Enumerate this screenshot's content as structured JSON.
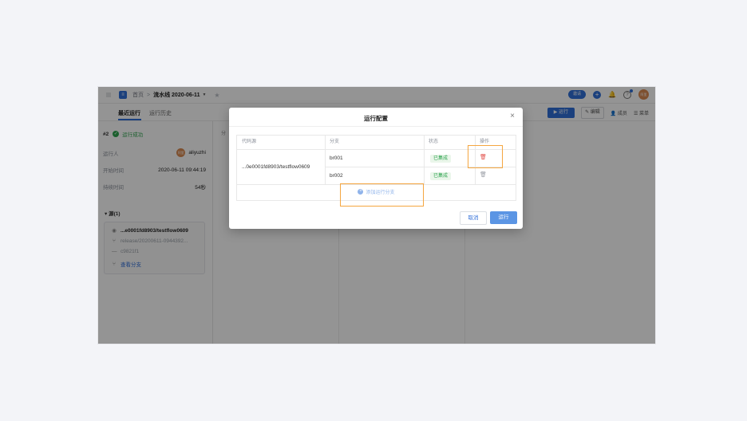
{
  "header": {
    "home": "首页",
    "separator": ">",
    "pipeline_name": "流水线 2020-06-11",
    "invite_label": "邀请",
    "avatar_text": "阿里"
  },
  "subbar": {
    "tabs": [
      {
        "label": "最近运行"
      },
      {
        "label": "运行历史"
      }
    ],
    "run_label": "运行",
    "edit_label": "编辑",
    "members_label": "成员",
    "menu_label": "菜单"
  },
  "run": {
    "number": "#2",
    "status": "运行成功",
    "runner_label": "运行人",
    "runner_name": "aliyuzhi",
    "runner_avatar": "阿里",
    "start_label": "开始时间",
    "start_time": "2020-06-11 09:44:19",
    "duration_label": "持续时间",
    "duration": "54秒"
  },
  "sources": {
    "section_title": "源(1)",
    "repo": "...e0001fd8903/testflow0609",
    "branch": "release/20200611-0944392...",
    "commit": "c9821f1",
    "view_branches": "查看分支"
  },
  "background": {
    "col_text": "分"
  },
  "modal": {
    "title": "运行配置",
    "columns": [
      "代码源",
      "分支",
      "状态",
      "操作"
    ],
    "repo": "...0e0001fd8903/testflow0609",
    "rows": [
      {
        "branch": "br001",
        "status": "已集成"
      },
      {
        "branch": "br002",
        "status": "已集成"
      }
    ],
    "add_branch": "添加运行分支",
    "cancel": "取消",
    "run": "运行"
  },
  "colors": {
    "accent": "#2f6ed8",
    "success": "#2ea44f",
    "highlight": "#f5a640",
    "danger": "#e2504b"
  },
  "icons": {
    "grid": "apps-grid-icon",
    "star": "star-icon",
    "bell": "bell-icon",
    "help": "help-icon",
    "close": "close-icon",
    "trash": "trash-icon",
    "add": "plus-circle-icon"
  }
}
